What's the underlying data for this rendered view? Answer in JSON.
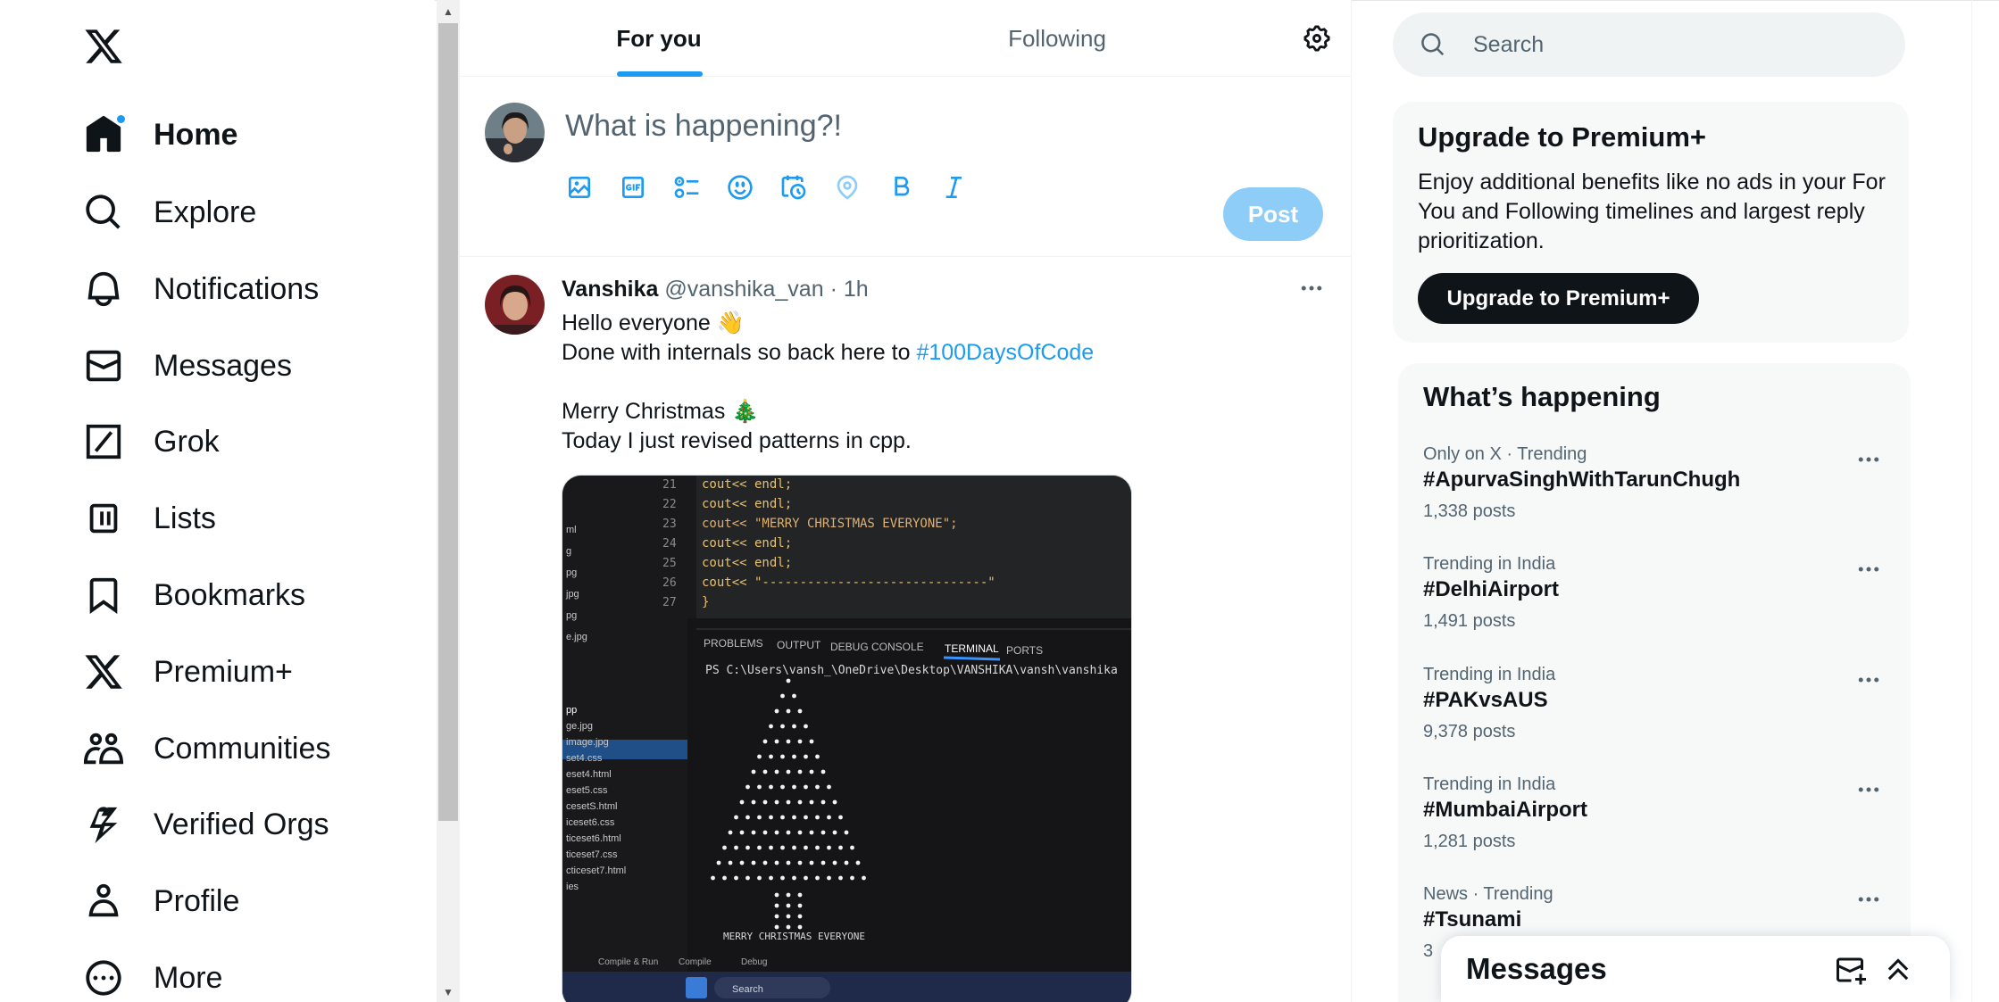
{
  "nav": {
    "logo": "x-logo",
    "items": [
      {
        "label": "Home",
        "icon": "home-icon",
        "active": true
      },
      {
        "label": "Explore",
        "icon": "search-icon"
      },
      {
        "label": "Notifications",
        "icon": "bell-icon"
      },
      {
        "label": "Messages",
        "icon": "envelope-icon"
      },
      {
        "label": "Grok",
        "icon": "grok-icon"
      },
      {
        "label": "Lists",
        "icon": "list-icon"
      },
      {
        "label": "Bookmarks",
        "icon": "bookmark-icon"
      },
      {
        "label": "Premium+",
        "icon": "x-icon"
      },
      {
        "label": "Communities",
        "icon": "people-icon"
      },
      {
        "label": "Verified Orgs",
        "icon": "lightning-icon"
      },
      {
        "label": "Profile",
        "icon": "person-icon"
      },
      {
        "label": "More",
        "icon": "more-circle-icon"
      }
    ]
  },
  "tabs": {
    "for_you": "For you",
    "following": "Following"
  },
  "composer": {
    "placeholder": "What is happening?!",
    "post_label": "Post"
  },
  "tweet": {
    "name": "Vanshika",
    "handle": "@vanshika_van",
    "time": "1h",
    "lines": [
      "Hello everyone 👋",
      "Done with internals so back here to ",
      "",
      "Merry Christmas 🎄",
      "Today I just revised patterns in cpp."
    ],
    "hashtag": "#100DaysOfCode",
    "media": {
      "code_lines": [
        {
          "n": "21",
          "code": "cout<< endl;"
        },
        {
          "n": "22",
          "code": "cout<< endl;"
        },
        {
          "n": "23",
          "code": "cout<< \"MERRY CHRISTMAS EVERYONE\";"
        },
        {
          "n": "24",
          "code": "cout<< endl;"
        },
        {
          "n": "25",
          "code": "cout<< endl;"
        },
        {
          "n": "26",
          "code": "cout<< \"------------------------------\""
        },
        {
          "n": "27",
          "code": "}"
        }
      ],
      "panel_tabs": [
        "PROBLEMS",
        "OUTPUT",
        "DEBUG CONSOLE",
        "TERMINAL",
        "PORTS"
      ],
      "terminal_prompt": "PS C:\\Users\\vansh_\\OneDrive\\Desktop\\VANSHIKA\\vansh\\vanshika",
      "output_text": "MERRY CHRISTMAS EVERYONE",
      "status_items": [
        "Compile & Run",
        "Compile",
        "Debug"
      ],
      "taskbar_search": "Search",
      "file_list": [
        "ml",
        "g",
        "pg",
        "jpg",
        "pg",
        "e.jpg",
        "pp",
        "ge.jpg",
        "image.jpg",
        "set4.css",
        "eset4.html",
        "eset5.css",
        "cesetS.html",
        "iceset6.css",
        "ticeset6.html",
        "ticeset7.css",
        "cticeset7.html",
        "ies"
      ]
    }
  },
  "search": {
    "placeholder": "Search"
  },
  "premium": {
    "title": "Upgrade to Premium+",
    "description": "Enjoy additional benefits like no ads in your For You and Following timelines and largest reply prioritization.",
    "button": "Upgrade to Premium+"
  },
  "trends": {
    "title": "What’s happening",
    "items": [
      {
        "context": "Only on X · Trending",
        "tag": "#ApurvaSinghWithTarunChugh",
        "count": "1,338 posts"
      },
      {
        "context": "Trending in India",
        "tag": "#DelhiAirport",
        "count": "1,491 posts"
      },
      {
        "context": "Trending in India",
        "tag": "#PAKvsAUS",
        "count": "9,378 posts"
      },
      {
        "context": "Trending in India",
        "tag": "#MumbaiAirport",
        "count": "1,281 posts"
      },
      {
        "context": "News · Trending",
        "tag": "#Tsunami",
        "count": "3"
      }
    ]
  },
  "messages_drawer": {
    "title": "Messages"
  },
  "colors": {
    "accent": "#1d9bf0",
    "post_disabled": "#8ecdf8",
    "text_primary": "#0f1419",
    "text_secondary": "#536471",
    "panel_bg": "#f7f9f9"
  }
}
